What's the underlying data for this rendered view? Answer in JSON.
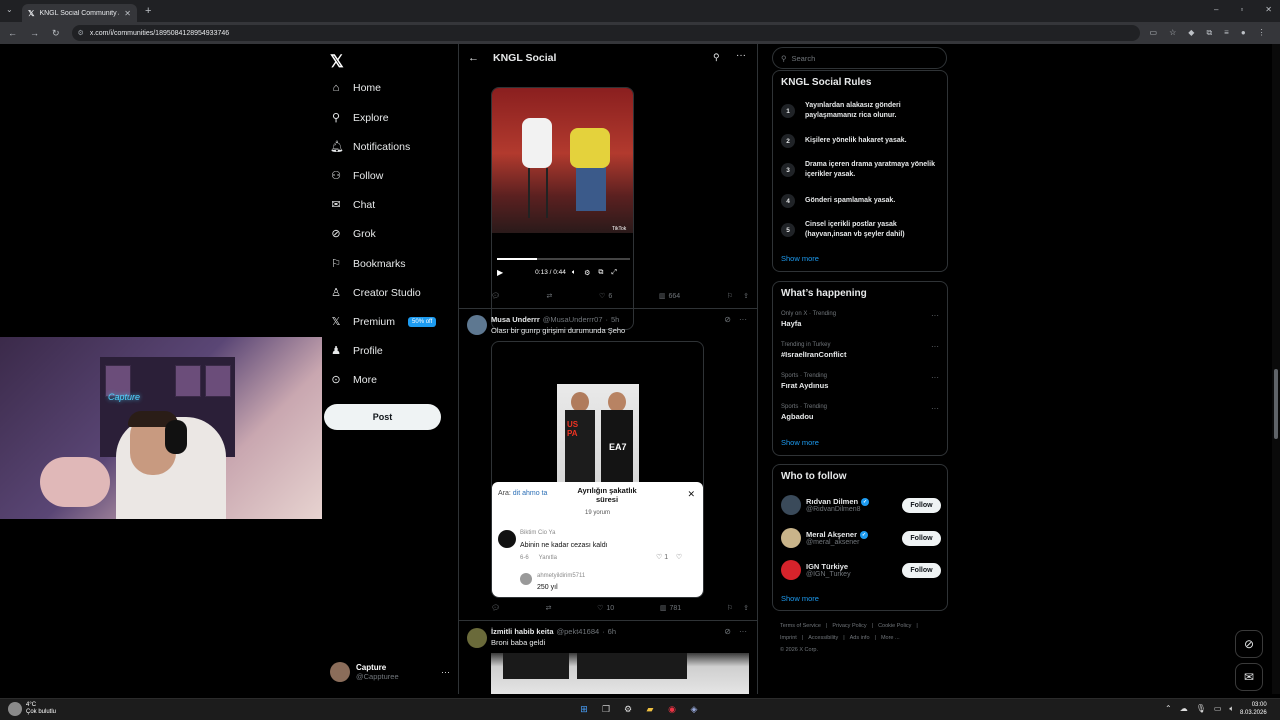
{
  "browser": {
    "tab_title": "KNGL Social Community / X",
    "url": "x.com/i/communities/1895084128954933746"
  },
  "nav": {
    "items": [
      {
        "label": "Home",
        "icon": "home-icon"
      },
      {
        "label": "Explore",
        "icon": "search-icon"
      },
      {
        "label": "Notifications",
        "icon": "bell-icon"
      },
      {
        "label": "Follow",
        "icon": "add-user-icon"
      },
      {
        "label": "Chat",
        "icon": "mail-icon"
      },
      {
        "label": "Grok",
        "icon": "grok-icon"
      },
      {
        "label": "Bookmarks",
        "icon": "bookmark-icon"
      },
      {
        "label": "Creator Studio",
        "icon": "creator-icon"
      },
      {
        "label": "Premium",
        "icon": "x-icon"
      },
      {
        "label": "Profile",
        "icon": "user-icon"
      },
      {
        "label": "More",
        "icon": "more-circle-icon"
      }
    ],
    "premium_badge": "50% off",
    "post_button": "Post",
    "account": {
      "name": "Capture",
      "handle": "@Cappturee"
    }
  },
  "timeline": {
    "title": "KNGL Social",
    "video": {
      "time": "0:13 / 0:44",
      "progress": 0.3,
      "watermark": "TikTok"
    },
    "post1_actions": {
      "reply": "",
      "repost": "",
      "likes": "6",
      "views": "664"
    },
    "post2": {
      "name": "Musa Underrr",
      "handle": "@MusaUnderrr07",
      "time": "5h",
      "text": "Olası bir gunrp girişimi durumunda Şeho",
      "overlay": {
        "search_prefix": "Ara:",
        "search_term": "dit ahmo ta",
        "title": "Ayrılığın şakatlık süresi",
        "count": "19 yorum",
        "comment1_user": "Biktim Cio Ya",
        "comment1_text": "Abinin ne kadar cezası kaldı",
        "comment1_meta": "6-6",
        "comment1_reply": "Yanıtla",
        "comment1_likes": "1",
        "comment2_user": "ahmetyildirim5711",
        "comment2_text": "250 yıl"
      },
      "actions": {
        "reply": "",
        "repost": "",
        "likes": "10",
        "views": "781"
      }
    },
    "post3": {
      "name": "İzmitli habib keita",
      "handle": "@pekt41684",
      "time": "6h",
      "text": "Broni baba geldi"
    }
  },
  "sidebar": {
    "search_placeholder": "Search",
    "rules": {
      "title": "KNGL Social Rules",
      "items": [
        {
          "num": "1",
          "text": "Yayınlardan alakasız gönderi paylaşmamanız rica olunur."
        },
        {
          "num": "2",
          "text": "Kişilere yönelik hakaret yasak."
        },
        {
          "num": "3",
          "text": "Drama içeren drama yaratmaya yönelik içerikler yasak."
        },
        {
          "num": "4",
          "text": "Gönderi spamlamak yasak."
        },
        {
          "num": "5",
          "text": "Cinsel içerikli postlar yasak (hayvan,insan vb şeyler dahil)"
        }
      ],
      "show_more": "Show more"
    },
    "happening": {
      "title": "What’s happening",
      "trends": [
        {
          "meta": "Only on X · Trending",
          "name": "Hayfa"
        },
        {
          "meta": "Trending in Turkey",
          "name": "#IsraelIranConflict"
        },
        {
          "meta": "Sports · Trending",
          "name": "Fırat Aydınus"
        },
        {
          "meta": "Sports · Trending",
          "name": "Agbadou"
        }
      ],
      "show_more": "Show more"
    },
    "who_to_follow": {
      "title": "Who to follow",
      "people": [
        {
          "name": "Rıdvan Dilmen",
          "handle": "@RidvanDilmen8",
          "verified": true,
          "color": "#3a4a5a"
        },
        {
          "name": "Meral Akşener",
          "handle": "@meral_aksener",
          "verified": true,
          "color": "#c9b48a"
        },
        {
          "name": "IGN Türkiye",
          "handle": "@IGN_Turkey",
          "verified": false,
          "color": "#d6232b"
        }
      ],
      "follow_label": "Follow",
      "show_more": "Show more"
    },
    "footer": [
      "Terms of Service",
      "|",
      "Privacy Policy",
      "|",
      "Cookie Policy",
      "|",
      "Imprint",
      "|",
      "Accessibility",
      "|",
      "Ads info",
      "|",
      "More ...",
      "© 2026 X Corp."
    ]
  },
  "taskbar": {
    "weather_temp": "4°C",
    "weather_desc": "Çok bulutlu",
    "time": "03:00",
    "date": "8.03.2026"
  },
  "colors": {
    "accent": "#1d9bf0",
    "background": "#000000",
    "border": "#2f3336"
  }
}
